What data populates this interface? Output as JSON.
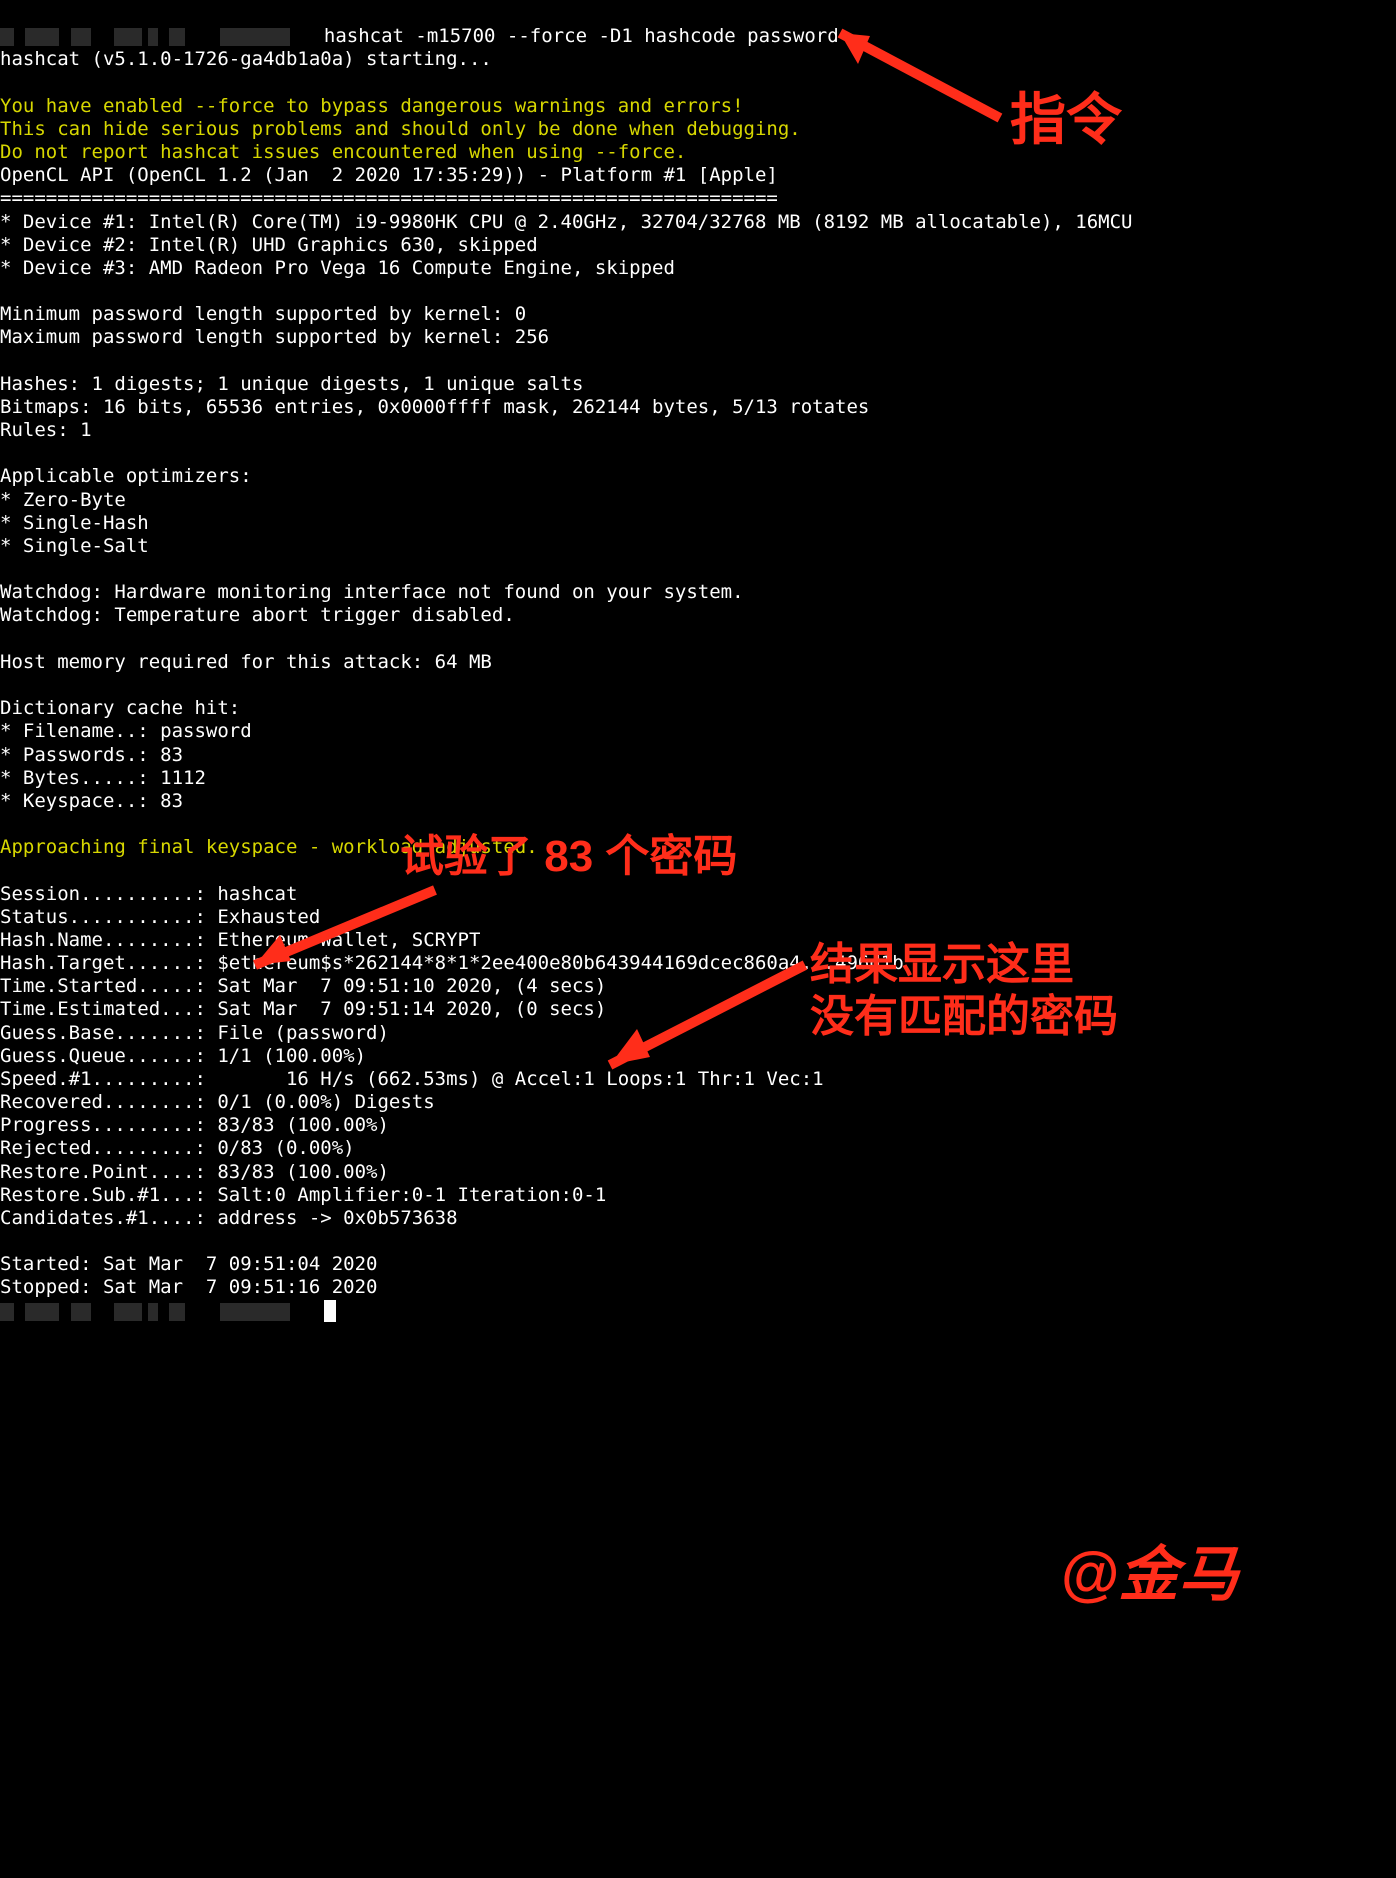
{
  "cmd": "hashcat -m15700 --force -D1 hashcode password",
  "starting": "hashcat (v5.1.0-1726-ga4db1a0a) starting...",
  "warn1": "You have enabled --force to bypass dangerous warnings and errors!",
  "warn2": "This can hide serious problems and should only be done when debugging.",
  "warn3": "Do not report hashcat issues encountered when using --force.",
  "opencl": "OpenCL API (OpenCL 1.2 (Jan  2 2020 17:35:29)) - Platform #1 [Apple]",
  "sep": "====================================================================",
  "dev1": "* Device #1: Intel(R) Core(TM) i9-9980HK CPU @ 2.40GHz, 32704/32768 MB (8192 MB allocatable), 16MCU",
  "dev2": "* Device #2: Intel(R) UHD Graphics 630, skipped",
  "dev3": "* Device #3: AMD Radeon Pro Vega 16 Compute Engine, skipped",
  "minpw": "Minimum password length supported by kernel: 0",
  "maxpw": "Maximum password length supported by kernel: 256",
  "hashes": "Hashes: 1 digests; 1 unique digests, 1 unique salts",
  "bitmaps": "Bitmaps: 16 bits, 65536 entries, 0x0000ffff mask, 262144 bytes, 5/13 rotates",
  "rules": "Rules: 1",
  "appopt": "Applicable optimizers:",
  "opt1": "* Zero-Byte",
  "opt2": "* Single-Hash",
  "opt3": "* Single-Salt",
  "wd1": "Watchdog: Hardware monitoring interface not found on your system.",
  "wd2": "Watchdog: Temperature abort trigger disabled.",
  "hostmem": "Host memory required for this attack: 64 MB",
  "dictcache": "Dictionary cache hit:",
  "dfile": "* Filename..: password",
  "dpw": "* Passwords.: 83",
  "dbytes": "* Bytes.....: 1112",
  "dks": "* Keyspace..: 83",
  "approach": "Approaching final keyspace - workload adjusted.",
  "s_session": "Session..........: hashcat",
  "s_status": "Status...........: Exhausted",
  "s_hashname": "Hash.Name........: Ethereum Wallet, SCRYPT",
  "s_hashtgt": "Hash.Target......: $ethereum$s*262144*8*1*2ee400e80b643944169dcec860a4...496d1b",
  "s_started": "Time.Started.....: Sat Mar  7 09:51:10 2020, (4 secs)",
  "s_est": "Time.Estimated...: Sat Mar  7 09:51:14 2020, (0 secs)",
  "s_gbase": "Guess.Base.......: File (password)",
  "s_gqueue": "Guess.Queue......: 1/1 (100.00%)",
  "s_speed": "Speed.#1.........:       16 H/s (662.53ms) @ Accel:1 Loops:1 Thr:1 Vec:1",
  "s_recov": "Recovered........: 0/1 (0.00%) Digests",
  "s_prog": "Progress.........: 83/83 (100.00%)",
  "s_rej": "Rejected.........: 0/83 (0.00%)",
  "s_rpoint": "Restore.Point....: 83/83 (100.00%)",
  "s_rsub": "Restore.Sub.#1...: Salt:0 Amplifier:0-1 Iteration:0-1",
  "s_cand": "Candidates.#1....: address -> 0x0b573638",
  "startedf": "Started: Sat Mar  7 09:51:04 2020",
  "stoppedf": "Stopped: Sat Mar  7 09:51:16 2020",
  "anno": {
    "cmd": "指令",
    "tried": "试验了 83 个密码",
    "result1": "结果显示这里",
    "result2": "没有匹配的密码",
    "sig": "@金马"
  }
}
